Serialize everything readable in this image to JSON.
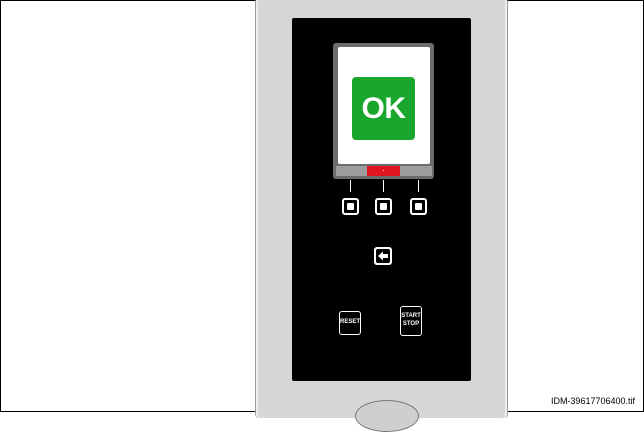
{
  "display": {
    "status_text": "OK",
    "softkey_indicator": "▪"
  },
  "buttons": {
    "reset_label": "RESET",
    "start_label": "START",
    "stop_label": "STOP"
  },
  "caption": "IDM-39617706400.tif",
  "colors": {
    "ok_green": "#19a62c",
    "softkey_red": "#e0141c",
    "panel_black": "#000000",
    "device_grey": "#d6d6d6"
  }
}
